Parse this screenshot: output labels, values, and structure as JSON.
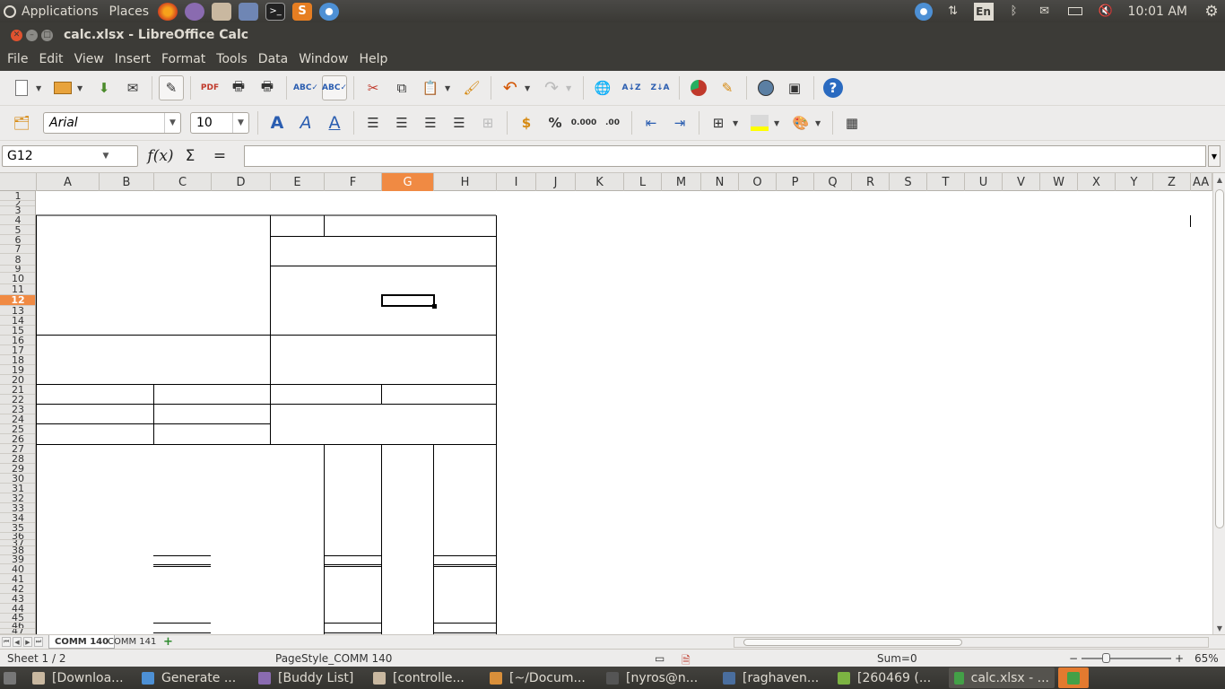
{
  "topbar": {
    "applications": "Applications",
    "places": "Places",
    "keyboard_layout": "En",
    "clock": "10:01 AM"
  },
  "window": {
    "title": "calc.xlsx - LibreOffice Calc"
  },
  "menu": [
    "File",
    "Edit",
    "View",
    "Insert",
    "Format",
    "Tools",
    "Data",
    "Window",
    "Help"
  ],
  "formatting": {
    "font_name": "Arial",
    "font_size": "10"
  },
  "formula_bar": {
    "cell_ref": "G12",
    "content": ""
  },
  "columns": [
    "A",
    "B",
    "C",
    "D",
    "E",
    "F",
    "G",
    "H",
    "I",
    "J",
    "K",
    "L",
    "M",
    "N",
    "O",
    "P",
    "Q",
    "R",
    "S",
    "T",
    "U",
    "V",
    "W",
    "X",
    "Y",
    "Z",
    "AA"
  ],
  "selected_column": "G",
  "rows": [
    "1",
    "2",
    "3",
    "4",
    "5",
    "6",
    "7",
    "8",
    "9",
    "10",
    "11",
    "12",
    "13",
    "14",
    "15",
    "16",
    "17",
    "18",
    "19",
    "20",
    "21",
    "22",
    "23",
    "24",
    "25",
    "26",
    "27",
    "28",
    "29",
    "30",
    "31",
    "32",
    "33",
    "34",
    "35",
    "36",
    "37",
    "38",
    "39",
    "40",
    "41",
    "42",
    "43",
    "44",
    "45",
    "46",
    "47"
  ],
  "selected_row": "12",
  "sheets": [
    {
      "name": "COMM 140",
      "active": true
    },
    {
      "name": "COMM 141",
      "active": false
    }
  ],
  "status": {
    "sheet": "Sheet 1 / 2",
    "page_style": "PageStyle_COMM 140",
    "sum": "Sum=0",
    "zoom": "65%"
  },
  "taskbar": [
    {
      "label": "[Downloa...",
      "color": "#c9b8a0"
    },
    {
      "label": "Generate ...",
      "color": "#4d90d5"
    },
    {
      "label": "[Buddy List]",
      "color": "#8a6bb0"
    },
    {
      "label": "[controlle...",
      "color": "#c9b8a0"
    },
    {
      "label": "[~/Docum...",
      "color": "#d98f3a"
    },
    {
      "label": "[nyros@n...",
      "color": "#555555"
    },
    {
      "label": "[raghaven...",
      "color": "#4a6e9e"
    },
    {
      "label": "[260469 (...",
      "color": "#7cb342"
    },
    {
      "label": "calc.xlsx - ...",
      "color": "#43a047"
    }
  ],
  "colors": {
    "accent": "#f08a43",
    "panel_dark": "#3c3b37"
  }
}
